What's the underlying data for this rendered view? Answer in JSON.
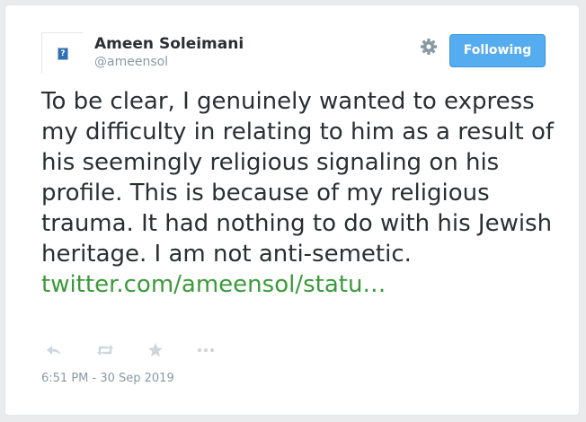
{
  "author": {
    "name": "Ameen Soleimani",
    "handle": "@ameensol",
    "avatar_placeholder": "?"
  },
  "header": {
    "follow_label": "Following",
    "settings_icon": "gear-icon"
  },
  "tweet": {
    "text": "To be clear, I genuinely wanted to express my difficulty in relating to him as a result of his seemingly religious signaling on his profile. This is because of my religious trauma. It had nothing to do with his Jewish heritage. I am not anti-semetic.",
    "link": "twitter.com/ameensol/statu…"
  },
  "actions": {
    "icons": [
      "reply-icon",
      "retweet-icon",
      "favorite-icon",
      "more-icon"
    ]
  },
  "meta": {
    "timestamp": "6:51 PM - 30 Sep 2019"
  },
  "colors": {
    "accent": "#55acee",
    "link": "#3a9a3a",
    "text": "#292f33",
    "muted": "#8899a6",
    "icon": "#ccd6dd"
  }
}
